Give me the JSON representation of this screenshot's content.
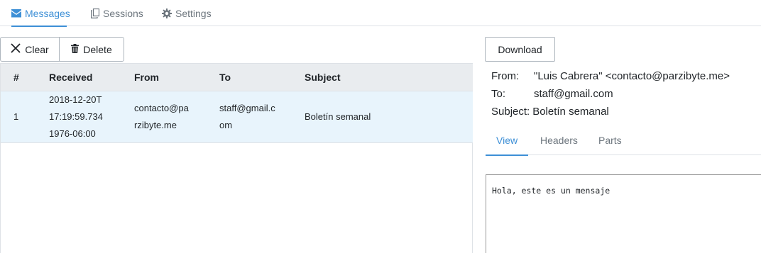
{
  "nav": {
    "tabs": [
      {
        "label": "Messages",
        "icon": "envelope-icon",
        "active": true
      },
      {
        "label": "Sessions",
        "icon": "copy-icon",
        "active": false
      },
      {
        "label": "Settings",
        "icon": "gear-icon",
        "active": false
      }
    ]
  },
  "toolbar": {
    "clear_label": "Clear",
    "delete_label": "Delete",
    "download_label": "Download"
  },
  "table": {
    "columns": [
      "#",
      "Received",
      "From",
      "To",
      "Subject"
    ],
    "rows": [
      {
        "num": "1",
        "received_lines": [
          "2018-12-20T",
          "17:19:59.734",
          "1976-06:00"
        ],
        "from_lines": [
          "contacto@pa",
          "rzibyte.me"
        ],
        "to_lines": [
          "staff@gmail.c",
          "om"
        ],
        "subject": "Boletín semanal"
      }
    ]
  },
  "message": {
    "from_key": "From:",
    "from_value": "\"Luis Cabrera\" <contacto@parzibyte.me>",
    "to_key": "To:",
    "to_value": "staff@gmail.com",
    "subject_key": "Subject:",
    "subject_value": "Boletín semanal",
    "tabs": [
      "View",
      "Headers",
      "Parts"
    ],
    "active_tab": "View",
    "body": "Hola, este es un mensaje"
  },
  "colors": {
    "accent": "#3d8fd6",
    "selected_row": "#e8f4fc",
    "header_bg": "#e9ecef"
  }
}
